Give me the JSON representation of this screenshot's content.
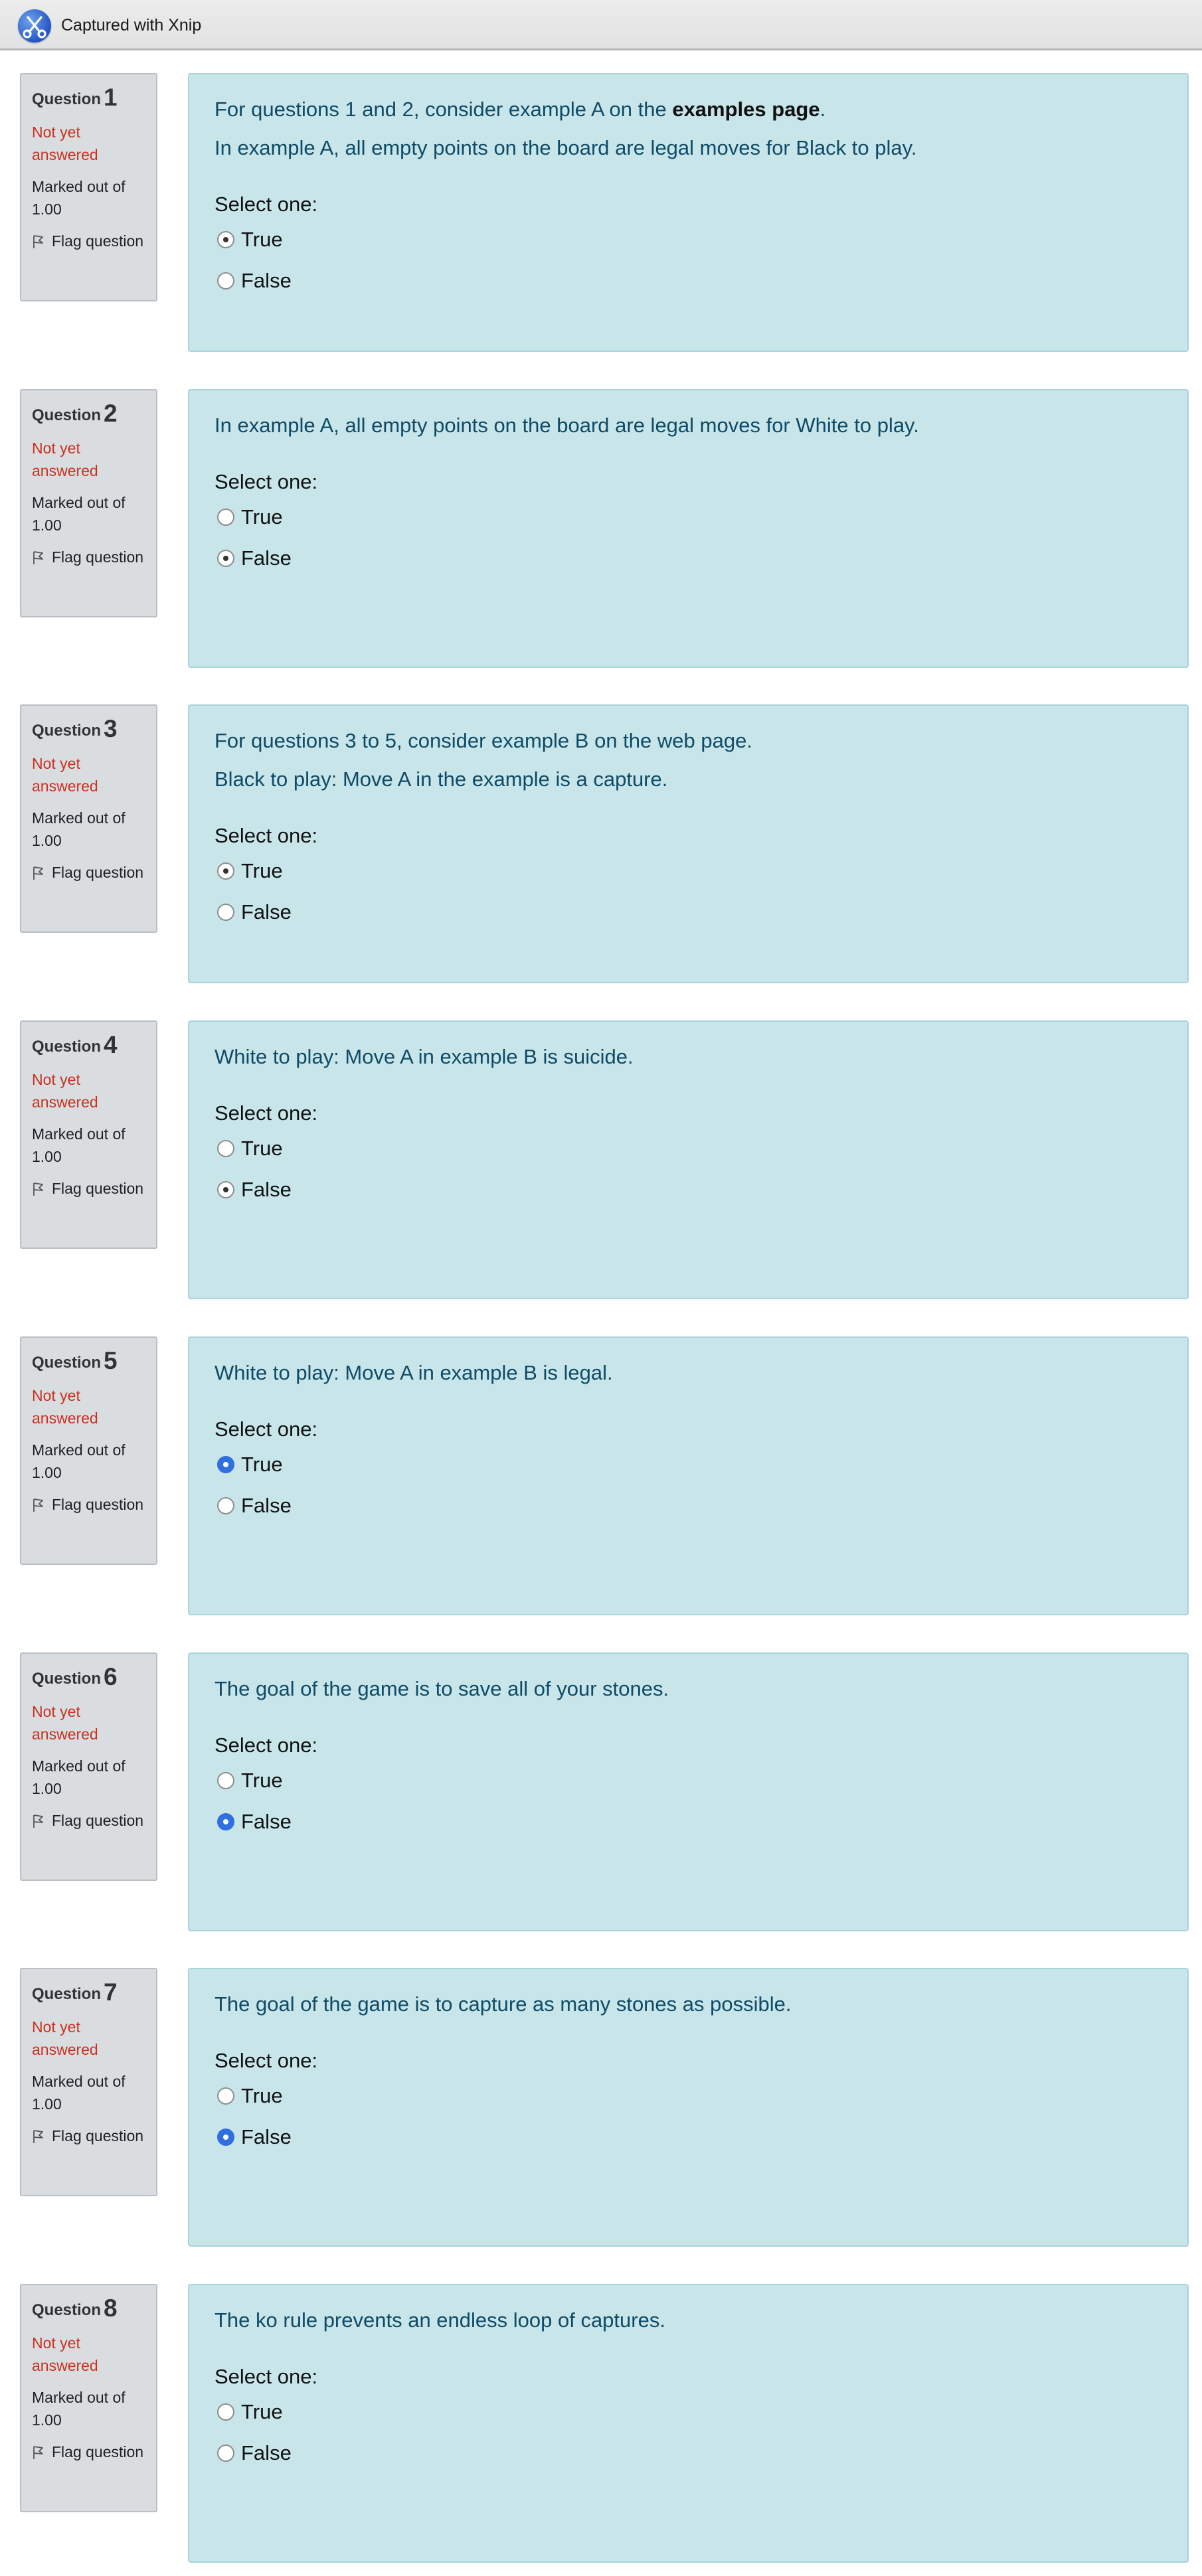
{
  "window": {
    "title": "Captured with Xnip",
    "icon": "scissors-icon"
  },
  "common": {
    "question_word": "Question",
    "state": "Not yet answered",
    "grade": "Marked out of 1.00",
    "flag": "Flag question",
    "prompt": "Select one:",
    "options": [
      "True",
      "False"
    ]
  },
  "questions": [
    {
      "number": "1",
      "text_parts": [
        {
          "text": "For questions 1 and 2, consider example A on the ",
          "bold": false
        },
        {
          "text": "examples page",
          "bold": true
        },
        {
          "text": ".",
          "bold": false
        }
      ],
      "text2": "In example A, all empty points on the board are legal moves for Black to play.",
      "selected": "True",
      "style": "plain"
    },
    {
      "number": "2",
      "text_parts": [
        {
          "text": "In example A, all empty points on the board are legal moves for White to play.",
          "bold": false
        }
      ],
      "text2": "",
      "selected": "False",
      "style": "plain"
    },
    {
      "number": "3",
      "text_parts": [
        {
          "text": "For questions 3 to 5, consider example B on the web page.",
          "bold": false
        }
      ],
      "text2": "Black to play: Move A in the example is a capture.",
      "selected": "True",
      "style": "plain"
    },
    {
      "number": "4",
      "text_parts": [
        {
          "text": "White to play: Move A in example B is suicide.",
          "bold": false
        }
      ],
      "text2": "",
      "selected": "False",
      "style": "plain"
    },
    {
      "number": "5",
      "text_parts": [
        {
          "text": "White to play: Move A in example B is legal.",
          "bold": false
        }
      ],
      "text2": "",
      "selected": "True",
      "style": "focused"
    },
    {
      "number": "6",
      "text_parts": [
        {
          "text": "The goal of the game is to save all of your stones.",
          "bold": false
        }
      ],
      "text2": "",
      "selected": "False",
      "style": "focused"
    },
    {
      "number": "7",
      "text_parts": [
        {
          "text": "The goal of the game is to capture as many stones as possible.",
          "bold": false
        }
      ],
      "text2": "",
      "selected": "False",
      "style": "focused"
    },
    {
      "number": "8",
      "text_parts": [
        {
          "text": "The ko rule prevents an endless loop of captures.",
          "bold": false
        }
      ],
      "text2": "",
      "selected": "",
      "style": "plain"
    }
  ]
}
